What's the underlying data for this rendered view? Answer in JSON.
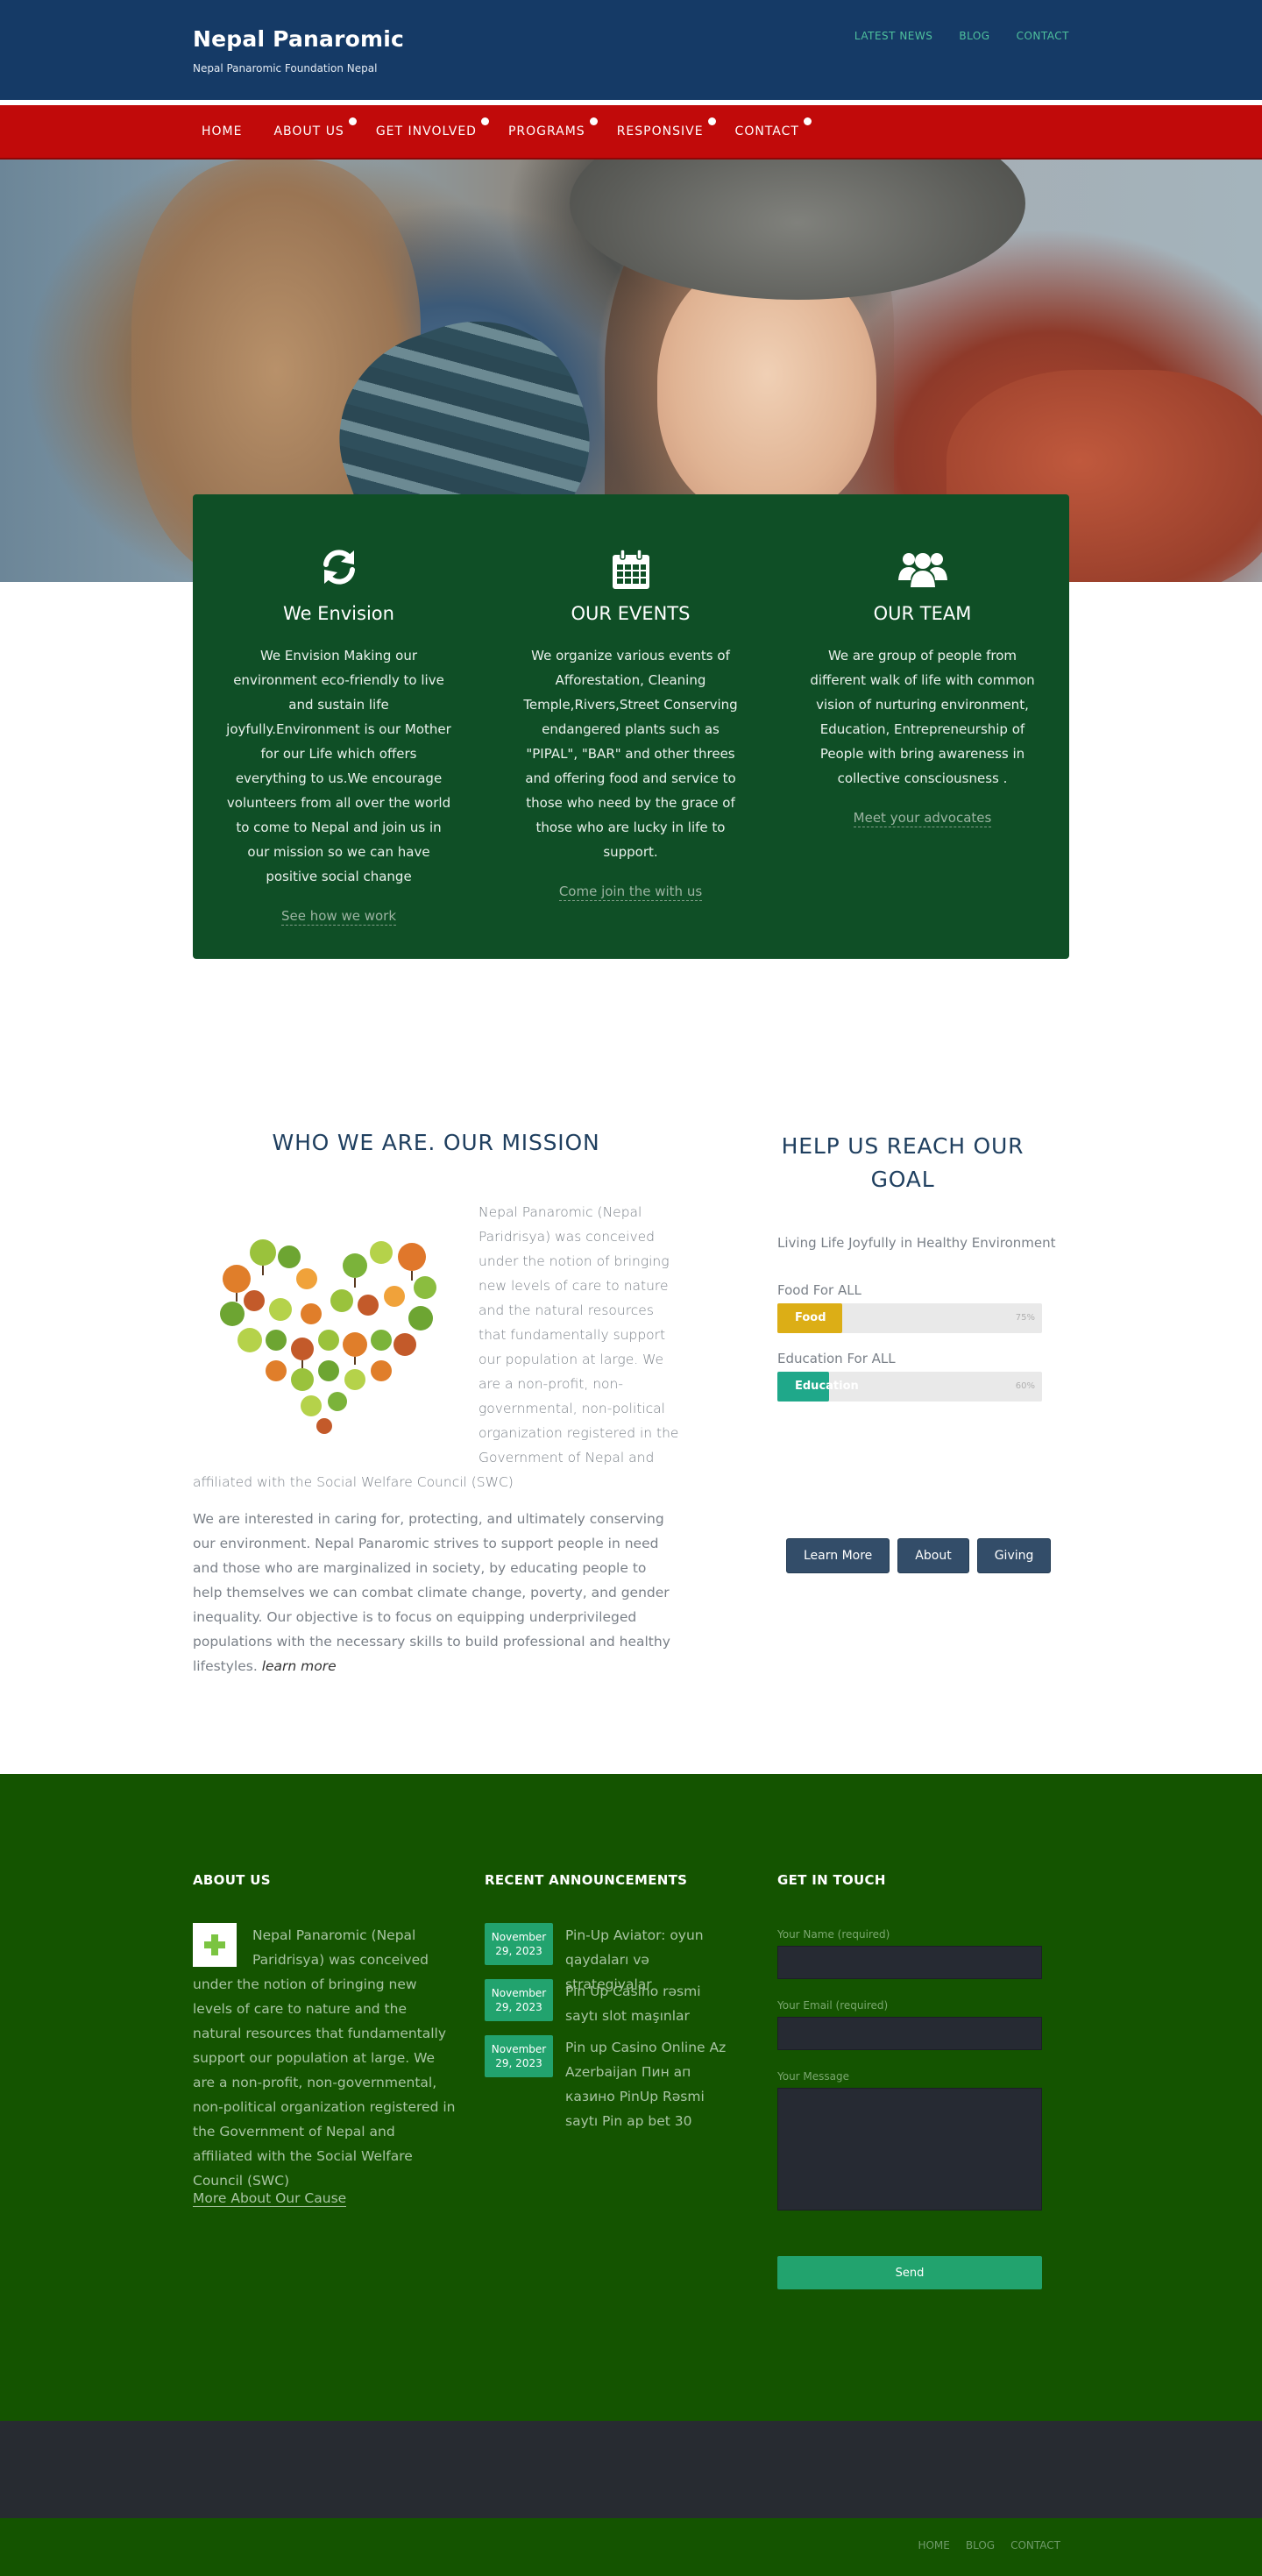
{
  "header": {
    "title": "Nepal Panaromic",
    "tagline": "Nepal Panaromic Foundation Nepal",
    "top_links": [
      "LATEST NEWS",
      "BLOG",
      "CONTACT"
    ]
  },
  "nav": {
    "items": [
      {
        "label": "HOME",
        "has_sub": false
      },
      {
        "label": "ABOUT US",
        "has_sub": true
      },
      {
        "label": "GET INVOLVED",
        "has_sub": true
      },
      {
        "label": "PROGRAMS",
        "has_sub": true
      },
      {
        "label": "RESPONSIVE",
        "has_sub": true
      },
      {
        "label": "CONTACT",
        "has_sub": true
      }
    ]
  },
  "features": [
    {
      "icon": "refresh-icon",
      "title": "We Envision",
      "text": "We Envision Making our environment eco-friendly to live and sustain life joyfully.Environment is our Mother for our Life which offers everything to us.We encourage volunteers from all over the world to come to Nepal and join us in our mission so we can have positive social change",
      "link": "See how we work"
    },
    {
      "icon": "calendar-icon",
      "title": "OUR EVENTS",
      "text": "We organize various events of Afforestation, Cleaning Temple,Rivers,Street  Conserving endangered plants such as \"PIPAL\", \"BAR\" and other threes and offering food and service to those who need by the grace of those who are lucky in life to support.",
      "link": "Come join the with us"
    },
    {
      "icon": "users-icon",
      "title": "OUR TEAM",
      "text": "We are group of people from different walk of life with common vision of nurturing environment, Education, Entrepreneurship of People with bring awareness in collective consciousness .",
      "link": "Meet your advocates"
    }
  ],
  "mission": {
    "title": "WHO WE ARE. OUR MISSION",
    "image": "tree-heart-illustration",
    "para1": "Nepal Panaromic (Nepal Paridrisya) was conceived under the notion of bringing new levels of care to nature and the natural resources that fundamentally support our population at large. We are a non-profit, non-governmental, non-political organization registered in the Government of Nepal and affiliated with the Social Welfare Council (SWC)",
    "para2": "We are interested in caring for, protecting, and ultimately conserving our environment. Nepal Panaromic strives to support people in need and those who are marginalized in society, by educating people to help themselves we can combat climate change, poverty, and gender inequality. Our objective is to focus on equipping underprivileged populations with the necessary skills to build professional and healthy lifestyles.",
    "learn_more": "learn more"
  },
  "goal": {
    "title": "HELP US REACH OUR GOAL",
    "intro": "Living Life Joyfully in Healthy Environment",
    "bars": [
      {
        "label": "Food For ALL",
        "tag": "Food",
        "percent": 0.75,
        "percent_text": "75%",
        "color": "#dcae16"
      },
      {
        "label": "Education For ALL",
        "tag": "Education",
        "percent": 0.6,
        "percent_text": "60%",
        "color": "#1fa88a"
      }
    ],
    "buttons": [
      "Learn More",
      "About",
      "Giving"
    ]
  },
  "footer": {
    "about_title": "ABOUT US",
    "about_text": "Nepal Panaromic (Nepal Paridrisya) was conceived under the notion of bringing new levels of care to nature and the natural resources that fundamentally support our population at large. We are a non-profit, non-governmental, non-political organization registered in the Government of Nepal and affiliated with the Social Welfare Council (SWC)",
    "about_link": "More About Our Cause",
    "ann_title": "RECENT ANNOUNCEMENTS",
    "announcements": [
      {
        "month": "November",
        "day": "29, 2023",
        "text": "Pin-Up Aviator: oyun qaydaları və strategiyalar"
      },
      {
        "month": "November",
        "day": "29, 2023",
        "text": "Pin Up Casino rəsmi saytı slot maşınlar"
      },
      {
        "month": "November",
        "day": "29, 2023",
        "text": "Pin up Casino Online Az Azerbaijan Пин ап казино PinUp Rəsmi saytı Pin ap bet 30"
      }
    ],
    "contact_title": "GET IN TOUCH",
    "form": {
      "name_label": "Your Name (required)",
      "email_label": "Your Email (required)",
      "message_label": "Your Message",
      "send": "Send"
    },
    "bottom_links": [
      "HOME",
      "BLOG",
      "CONTACT"
    ]
  }
}
